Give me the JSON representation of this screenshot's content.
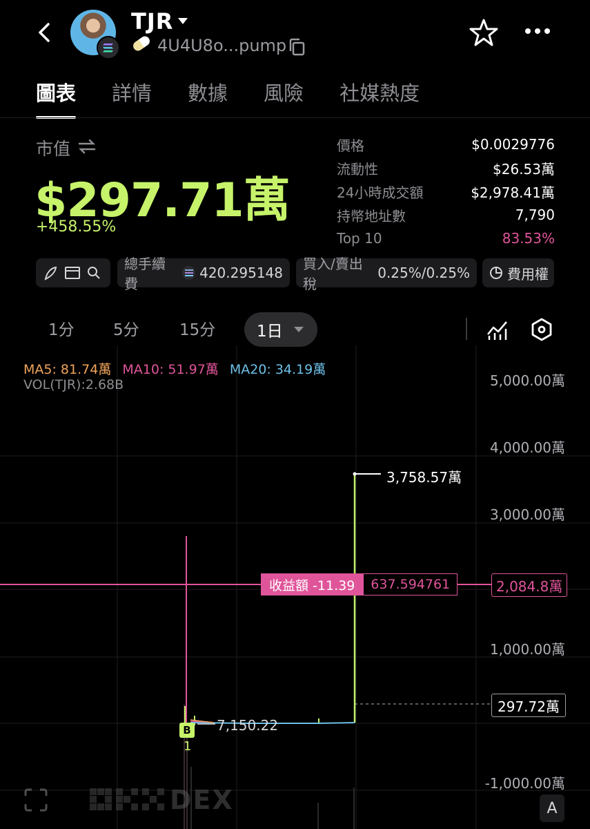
{
  "header": {
    "token_name": "TJR",
    "address": "4U4U8o...pump",
    "colors": {
      "accent_green": "#c6f36a",
      "accent_pink": "#e0559a",
      "ma5": "#f0a45c",
      "ma10": "#e0559a",
      "ma20": "#6ec0e8"
    }
  },
  "tabs": [
    "圖表",
    "詳情",
    "數據",
    "風險",
    "社媒熱度"
  ],
  "market_cap": {
    "label": "市值",
    "value": "$297.71萬",
    "change": "+458.55%"
  },
  "stats": [
    {
      "key": "價格",
      "value": "$0.0029776"
    },
    {
      "key": "流動性",
      "value": "$26.53萬"
    },
    {
      "key": "24小時成交額",
      "value": "$2,978.41萬"
    },
    {
      "key": "持幣地址數",
      "value": "7,790"
    },
    {
      "key": "Top 10",
      "value": "83.53%"
    }
  ],
  "chips": {
    "total_fee_label": "總手續費",
    "total_fee_value": "420.295148",
    "tax_label": "買入/賣出稅",
    "tax_value": "0.25%/0.25%",
    "fee_rights_label": "費用權"
  },
  "intervals": {
    "options": [
      "1分",
      "5分",
      "15分"
    ],
    "active": "1日"
  },
  "chart": {
    "ma5": "MA5: 81.74萬",
    "ma10": "MA10: 51.97萬",
    "ma20": "MA20: 34.19萬",
    "vol": "VOL(TJR):2.68B",
    "y_labels": [
      "5,000.00萬",
      "4,000.00萬",
      "3,000.00萬",
      "1,000.00萬",
      "-1,000.00萬"
    ],
    "high_label": "3,758.57萬",
    "low_label": "7,150.22",
    "profit_label": "收益額 -11.39",
    "profit_value": "637.594761",
    "crosshair_price": "2,084.8萬",
    "current_price": "297.72萬",
    "buy_marker": "B",
    "buy_count": "1",
    "watermark": "DEX",
    "a_button": "A"
  }
}
